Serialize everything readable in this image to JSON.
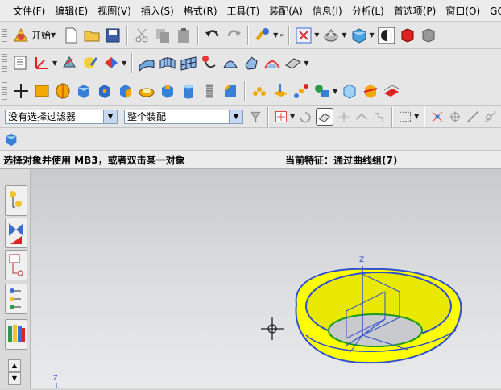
{
  "menu": {
    "items": [
      "文件(F)",
      "编辑(E)",
      "视图(V)",
      "插入(S)",
      "格式(R)",
      "工具(T)",
      "装配(A)",
      "信息(I)",
      "分析(L)",
      "首选项(P)",
      "窗口(O)",
      "GC 工"
    ]
  },
  "toolbar1": {
    "start_label": "开始"
  },
  "filter": {
    "selection_filter": "没有选择过滤器",
    "scope": "整个装配"
  },
  "status": {
    "prompt": "选择对象并使用 MB3，或者双击某一对象",
    "current_feature": "当前特征：通过曲线组(7)"
  },
  "viewport": {
    "axis_z": "Z",
    "axis_z_small": "Z"
  },
  "colors": {
    "torus_fill": "#ffff00",
    "torus_edge": "#2f4fd0",
    "csys_green": "#1a9a1a"
  }
}
